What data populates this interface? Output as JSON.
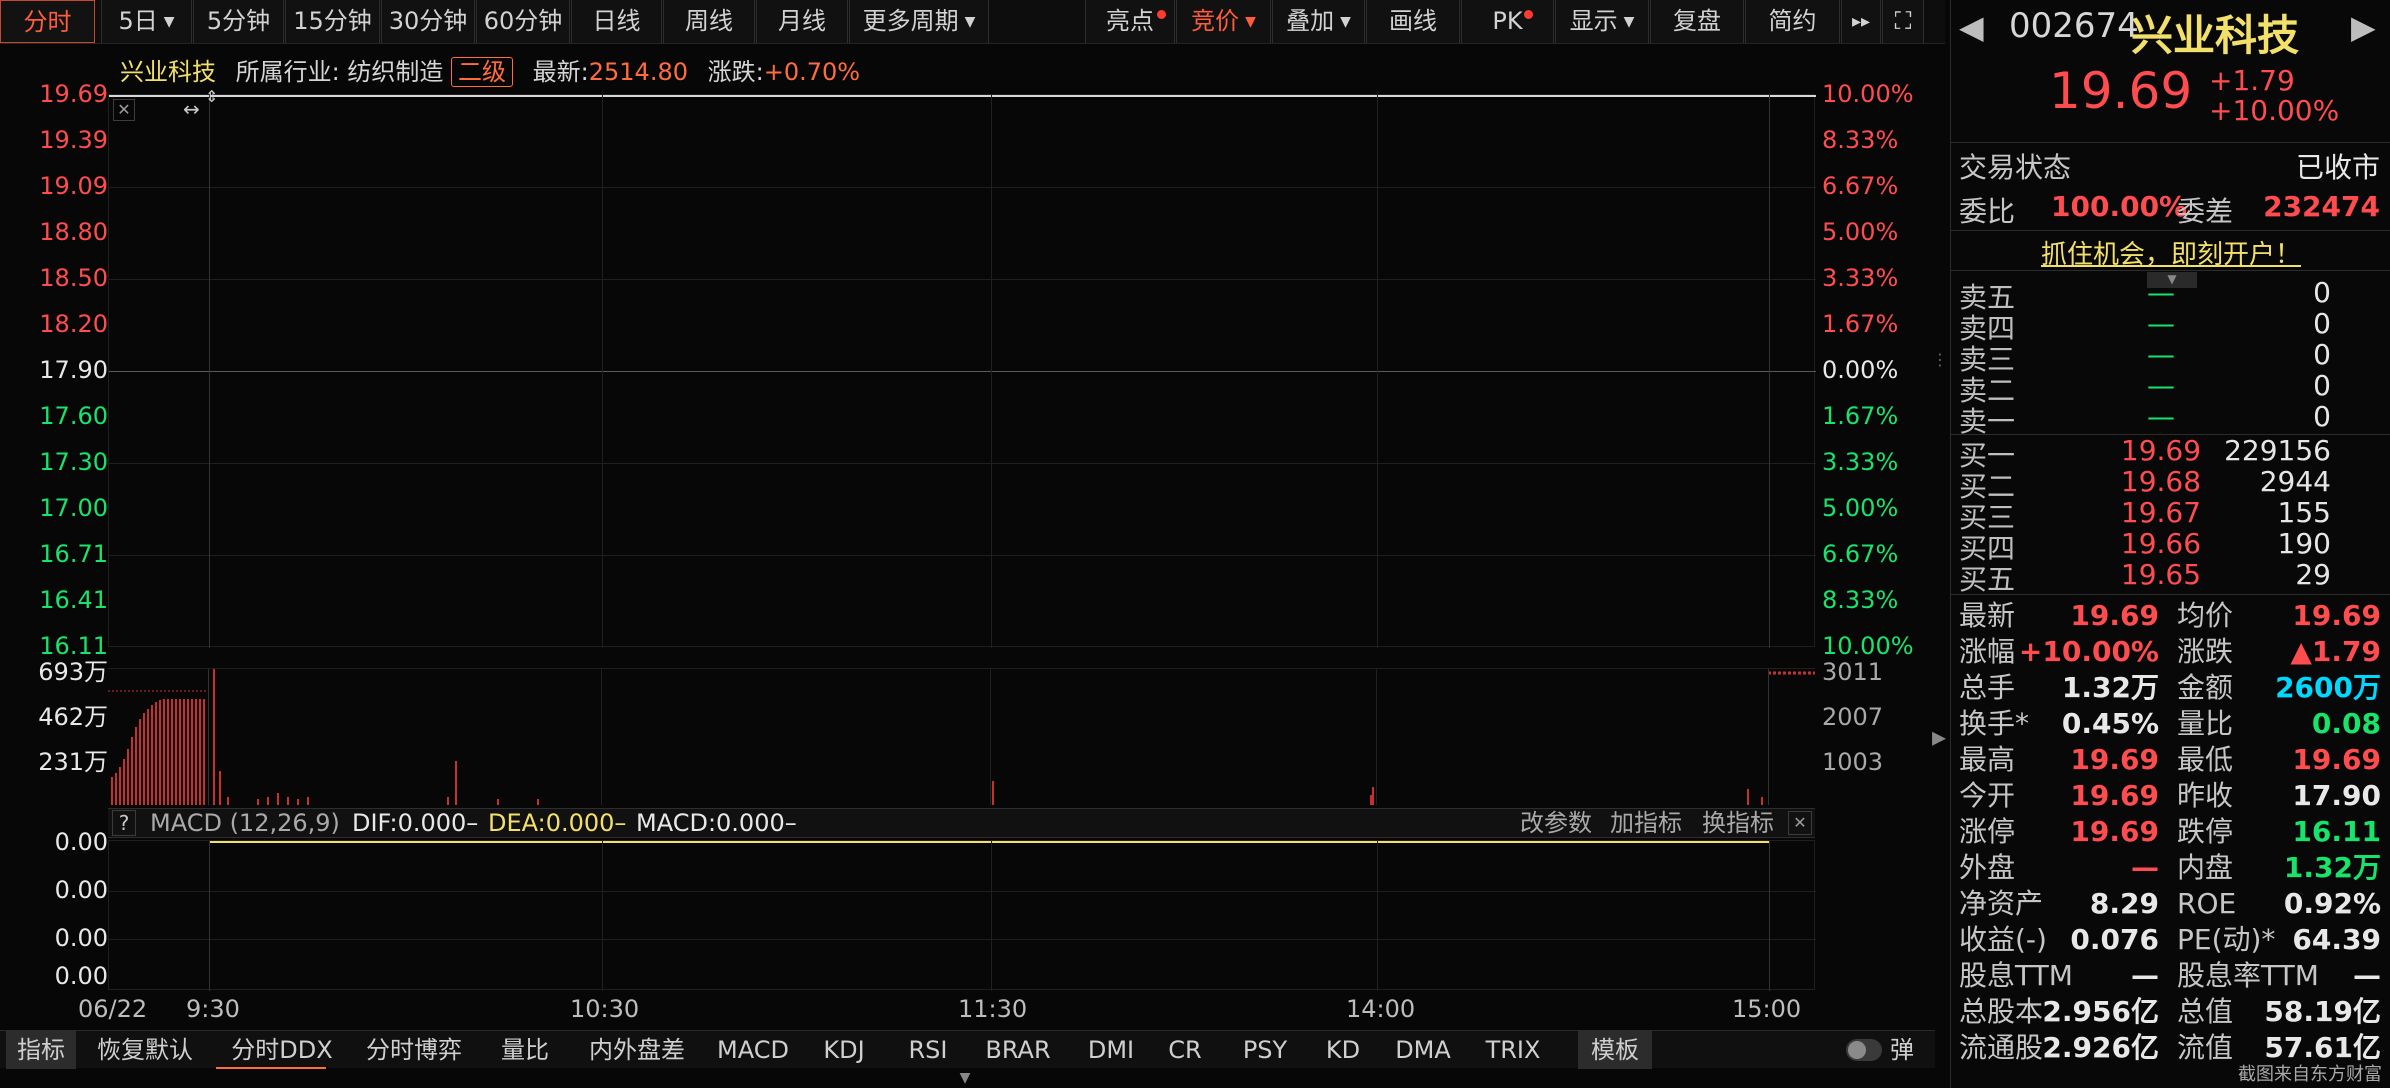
{
  "toolbar": {
    "left_tabs": [
      "分时",
      "5日",
      "5分钟",
      "15分钟",
      "30分钟",
      "60分钟",
      "日线",
      "周线",
      "月线",
      "更多周期"
    ],
    "right_tabs": [
      "亮点",
      "竞价",
      "叠加",
      "画线",
      "PK",
      "显示",
      "复盘",
      "简约",
      "▸▸",
      "⛶"
    ]
  },
  "infobar": {
    "stock_name": "兴业科技",
    "industry_label": "所属行业:",
    "industry": "纺织制造",
    "level": "二级",
    "latest_label": "最新:",
    "latest": "2514.80",
    "change_label": "涨跌:",
    "change": "+0.70%"
  },
  "price_axis": {
    "left": [
      "19.69",
      "19.39",
      "19.09",
      "18.80",
      "18.50",
      "18.20",
      "17.90",
      "17.60",
      "17.30",
      "17.00",
      "16.71",
      "16.41",
      "16.11"
    ],
    "right": [
      "10.00%",
      "8.33%",
      "6.67%",
      "5.00%",
      "3.33%",
      "1.67%",
      "0.00%",
      "1.67%",
      "3.33%",
      "5.00%",
      "6.67%",
      "8.33%",
      "10.00%"
    ]
  },
  "volume_axis": {
    "left": [
      "693万",
      "462万",
      "231万"
    ],
    "right": [
      "3011",
      "2007",
      "1003"
    ]
  },
  "macd": {
    "help": "?",
    "name": "MACD (12,26,9)",
    "dif": "DIF:0.000–",
    "dea": "DEA:0.000–",
    "macd": "MACD:0.000–",
    "actions": [
      "改参数",
      "加指标",
      "换指标"
    ],
    "axis": [
      "0.00",
      "0.00",
      "0.00",
      "0.00"
    ]
  },
  "time_axis": [
    "06/22",
    "9:30",
    "10:30",
    "11:30",
    "14:00",
    "15:00"
  ],
  "bottom_tabs": [
    "指标",
    "恢复默认",
    "分时DDX",
    "分时博弈",
    "量比",
    "内外盘差",
    "MACD",
    "KDJ",
    "RSI",
    "BRAR",
    "DMI",
    "CR",
    "PSY",
    "KD",
    "DMA",
    "TRIX",
    "模板",
    "弹"
  ],
  "quote": {
    "code": "002674",
    "name": "兴业科技",
    "price": "19.69",
    "change": "+1.79",
    "change_pct": "+10.00%",
    "status_label": "交易状态",
    "status": "已收市",
    "webi_label": "委比",
    "webi": "100.00%",
    "weicha_label": "委差",
    "weicha": "232474",
    "promo": "抓住机会，即刻开户！"
  },
  "orderbook": {
    "sell": [
      {
        "label": "卖五",
        "price": "—",
        "vol": "0"
      },
      {
        "label": "卖四",
        "price": "—",
        "vol": "0"
      },
      {
        "label": "卖三",
        "price": "—",
        "vol": "0"
      },
      {
        "label": "卖二",
        "price": "—",
        "vol": "0"
      },
      {
        "label": "卖一",
        "price": "—",
        "vol": "0"
      }
    ],
    "buy": [
      {
        "label": "买一",
        "price": "19.69",
        "vol": "229156"
      },
      {
        "label": "买二",
        "price": "19.68",
        "vol": "2944"
      },
      {
        "label": "买三",
        "price": "19.67",
        "vol": "155"
      },
      {
        "label": "买四",
        "price": "19.66",
        "vol": "190"
      },
      {
        "label": "买五",
        "price": "19.65",
        "vol": "29"
      }
    ]
  },
  "stats": [
    {
      "k1": "最新",
      "v1": "19.69",
      "c1": "red",
      "k2": "均价",
      "v2": "19.69",
      "c2": "red"
    },
    {
      "k1": "涨幅",
      "v1": "+10.00%",
      "c1": "red",
      "k2": "涨跌",
      "v2": "▲1.79",
      "c2": "red"
    },
    {
      "k1": "总手",
      "v1": "1.32万",
      "c1": "white",
      "k2": "金额",
      "v2": "2600万",
      "c2": "cyan"
    },
    {
      "k1": "换手*",
      "v1": "0.45%",
      "c1": "white",
      "k2": "量比",
      "v2": "0.08",
      "c2": "green"
    },
    {
      "k1": "最高",
      "v1": "19.69",
      "c1": "red",
      "k2": "最低",
      "v2": "19.69",
      "c2": "red"
    },
    {
      "k1": "今开",
      "v1": "19.69",
      "c1": "red",
      "k2": "昨收",
      "v2": "17.90",
      "c2": "white"
    },
    {
      "k1": "涨停",
      "v1": "19.69",
      "c1": "red",
      "k2": "跌停",
      "v2": "16.11",
      "c2": "green"
    },
    {
      "k1": "外盘",
      "v1": "—",
      "c1": "red",
      "k2": "内盘",
      "v2": "1.32万",
      "c2": "green"
    },
    {
      "k1": "净资产",
      "v1": "8.29",
      "c1": "white",
      "k2": "ROE",
      "v2": "0.92%",
      "c2": "white"
    },
    {
      "k1": "收益(-)",
      "v1": "0.076",
      "c1": "white",
      "k2": "PE(动)*",
      "v2": "64.39",
      "c2": "white"
    },
    {
      "k1": "股息TTM",
      "v1": "—",
      "c1": "white",
      "k2": "股息率TTM",
      "v2": "—",
      "c2": "white"
    },
    {
      "k1": "总股本",
      "v1": "2.956亿",
      "c1": "white",
      "k2": "总值",
      "v2": "58.19亿",
      "c2": "white"
    },
    {
      "k1": "流通股",
      "v1": "2.926亿",
      "c1": "white",
      "k2": "流值",
      "v2": "57.61亿",
      "c2": "white"
    }
  ],
  "watermark": "截图来自东方财富",
  "colors": {
    "up": "#ff4d4f",
    "down": "#18e36a",
    "accent": "#ff6d3d",
    "line": "#f3e06b"
  }
}
